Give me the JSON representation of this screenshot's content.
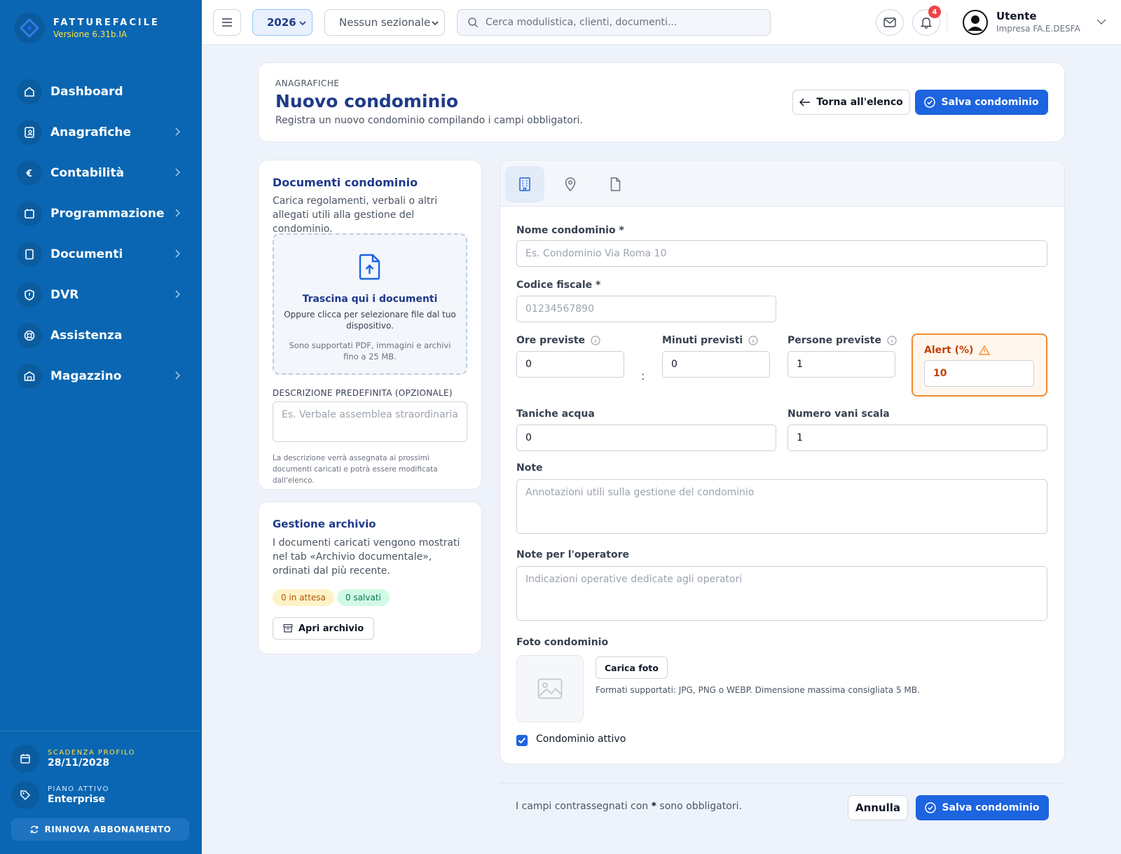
{
  "brand": {
    "name": "FATTUREFACILE",
    "version": "Versione 6.31b.IA"
  },
  "nav": [
    {
      "label": "Dashboard",
      "icon": "home-icon",
      "has_children": false
    },
    {
      "label": "Anagrafiche",
      "icon": "contacts-icon",
      "has_children": true
    },
    {
      "label": "Contabilità",
      "icon": "euro-icon",
      "has_children": true
    },
    {
      "label": "Programmazione",
      "icon": "calendar-icon",
      "has_children": true
    },
    {
      "label": "Documenti",
      "icon": "document-icon",
      "has_children": true
    },
    {
      "label": "DVR",
      "icon": "shield-icon",
      "has_children": true
    },
    {
      "label": "Assistenza",
      "icon": "lifebuoy-icon",
      "has_children": false
    },
    {
      "label": "Magazzino",
      "icon": "warehouse-icon",
      "has_children": true
    }
  ],
  "profile": {
    "expiry_label": "SCADENZA PROFILO",
    "expiry_value": "28/11/2028",
    "plan_label": "PIANO ATTIVO",
    "plan_value": "Enterprise",
    "renew_label": "RINNOVA ABBONAMENTO"
  },
  "topbar": {
    "year": "2026",
    "sezionale": "Nessun sezionale",
    "search_placeholder": "Cerca modulistica, clienti, documenti...",
    "notifications_count": "4",
    "user_name": "Utente",
    "user_company": "Impresa FA.E.DESFA"
  },
  "header": {
    "overline": "ANAGRAFICHE",
    "title": "Nuovo condominio",
    "subtitle": "Registra un nuovo condominio compilando i campi obbligatori.",
    "back_label": "Torna all'elenco",
    "save_label": "Salva condominio"
  },
  "docs": {
    "title": "Documenti condominio",
    "description": "Carica regolamenti, verbali o altri allegati utili alla gestione del condominio.",
    "drop_title": "Trascina qui i documenti",
    "drop_sub": "Oppure clicca per selezionare file dal tuo dispositivo.",
    "drop_note": "Sono supportati PDF, immagini e archivi fino a 25 MB.",
    "desc_label": "DESCRIZIONE PREDEFINITA (OPZIONALE)",
    "desc_placeholder": "Es. Verbale assemblea straordinaria",
    "desc_help": "La descrizione verrà assegnata ai prossimi documenti caricati e potrà essere modificata dall'elenco."
  },
  "archive": {
    "title": "Gestione archivio",
    "description": "I documenti caricati vengono mostrati nel tab «Archivio documentale», ordinati dal più recente.",
    "pending": "0 in attesa",
    "saved": "0 salvati",
    "open_label": "Apri archivio"
  },
  "form": {
    "tabs": [
      "building-icon",
      "map-pin-icon",
      "file-icon"
    ],
    "nome_label": "Nome condominio *",
    "nome_placeholder": "Es. Condominio Via Roma 10",
    "cf_label": "Codice fiscale *",
    "cf_placeholder": "01234567890",
    "ore_label": "Ore previste",
    "ore_value": "0",
    "minuti_label": "Minuti previsti",
    "minuti_value": "0",
    "separator": ":",
    "persone_label": "Persone previste",
    "persone_value": "1",
    "alert_label": "Alert (%)",
    "alert_value": "10",
    "taniche_label": "Taniche acqua",
    "taniche_value": "0",
    "vani_label": "Numero vani scala",
    "vani_value": "1",
    "note_label": "Note",
    "note_placeholder": "Annotazioni utili sulla gestione del condominio",
    "note_op_label": "Note per l'operatore",
    "note_op_placeholder": "Indicazioni operative dedicate agli operatori",
    "foto_label": "Foto condominio",
    "foto_button": "Carica foto",
    "foto_note": "Formati supportati: JPG, PNG o WEBP. Dimensione massima consigliata 5 MB.",
    "active_label": "Condominio attivo",
    "active_checked": true
  },
  "footer": {
    "required_before": "I campi contrassegnati con",
    "required_star": "*",
    "required_after": "sono obbligatori.",
    "cancel_label": "Annulla",
    "save_label": "Salva condominio"
  },
  "colors": {
    "sidebar": "#0a66b2",
    "primary": "#1d64e0",
    "title": "#1e3a8a",
    "alert": "#f08b35",
    "badge": "#ef4444"
  }
}
